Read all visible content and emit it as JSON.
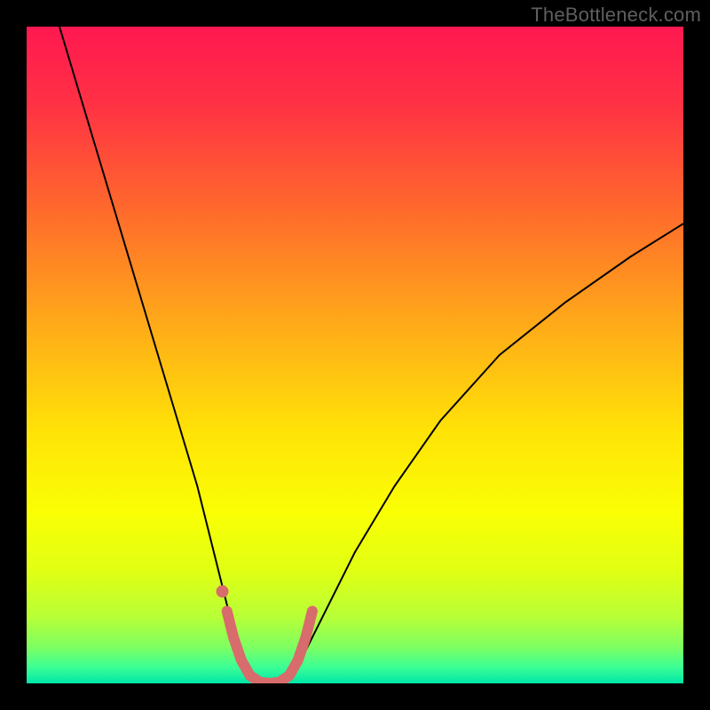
{
  "watermark": "TheBottleneck.com",
  "chart_data": {
    "type": "line",
    "title": "",
    "xlabel": "",
    "ylabel": "",
    "xlim": [
      0,
      100
    ],
    "ylim": [
      0,
      100
    ],
    "grid": false,
    "background_gradient": {
      "stops": [
        {
          "offset": 0.0,
          "color": "#ff1850"
        },
        {
          "offset": 0.12,
          "color": "#ff3244"
        },
        {
          "offset": 0.28,
          "color": "#ff6a2c"
        },
        {
          "offset": 0.45,
          "color": "#ffa919"
        },
        {
          "offset": 0.62,
          "color": "#ffe407"
        },
        {
          "offset": 0.74,
          "color": "#faff04"
        },
        {
          "offset": 0.83,
          "color": "#e0ff14"
        },
        {
          "offset": 0.9,
          "color": "#b7ff37"
        },
        {
          "offset": 0.945,
          "color": "#7dff62"
        },
        {
          "offset": 0.975,
          "color": "#3cff95"
        },
        {
          "offset": 1.0,
          "color": "#00e6a8"
        }
      ]
    },
    "series": [
      {
        "name": "bottleneck-curve",
        "color": "#000000",
        "stroke_width": 2,
        "points": [
          {
            "x": 5.0,
            "y": 100.0
          },
          {
            "x": 8.0,
            "y": 90.0
          },
          {
            "x": 11.0,
            "y": 80.0
          },
          {
            "x": 14.0,
            "y": 70.0
          },
          {
            "x": 17.0,
            "y": 60.0
          },
          {
            "x": 20.0,
            "y": 50.0
          },
          {
            "x": 23.0,
            "y": 40.0
          },
          {
            "x": 26.0,
            "y": 30.0
          },
          {
            "x": 28.5,
            "y": 20.0
          },
          {
            "x": 30.5,
            "y": 12.0
          },
          {
            "x": 32.0,
            "y": 6.0
          },
          {
            "x": 33.5,
            "y": 2.0
          },
          {
            "x": 35.0,
            "y": 0.3
          },
          {
            "x": 37.0,
            "y": 0.0
          },
          {
            "x": 39.0,
            "y": 0.3
          },
          {
            "x": 41.0,
            "y": 2.0
          },
          {
            "x": 43.0,
            "y": 6.0
          },
          {
            "x": 46.0,
            "y": 12.0
          },
          {
            "x": 50.0,
            "y": 20.0
          },
          {
            "x": 56.0,
            "y": 30.0
          },
          {
            "x": 63.0,
            "y": 40.0
          },
          {
            "x": 72.0,
            "y": 50.0
          },
          {
            "x": 82.0,
            "y": 58.0
          },
          {
            "x": 92.0,
            "y": 65.0
          },
          {
            "x": 100.0,
            "y": 70.0
          }
        ]
      },
      {
        "name": "highlight-segment",
        "color": "#d86b6b",
        "stroke_width": 12,
        "points": [
          {
            "x": 30.5,
            "y": 11.0
          },
          {
            "x": 31.5,
            "y": 7.0
          },
          {
            "x": 32.7,
            "y": 3.5
          },
          {
            "x": 34.0,
            "y": 1.2
          },
          {
            "x": 35.5,
            "y": 0.2
          },
          {
            "x": 37.0,
            "y": 0.0
          },
          {
            "x": 38.5,
            "y": 0.2
          },
          {
            "x": 40.0,
            "y": 1.2
          },
          {
            "x": 41.3,
            "y": 3.5
          },
          {
            "x": 42.5,
            "y": 7.0
          },
          {
            "x": 43.5,
            "y": 11.0
          }
        ]
      },
      {
        "name": "highlight-dot",
        "color": "#d86b6b",
        "type_hint": "scatter",
        "marker_size": 7,
        "points": [
          {
            "x": 29.8,
            "y": 14.0
          }
        ]
      }
    ]
  }
}
